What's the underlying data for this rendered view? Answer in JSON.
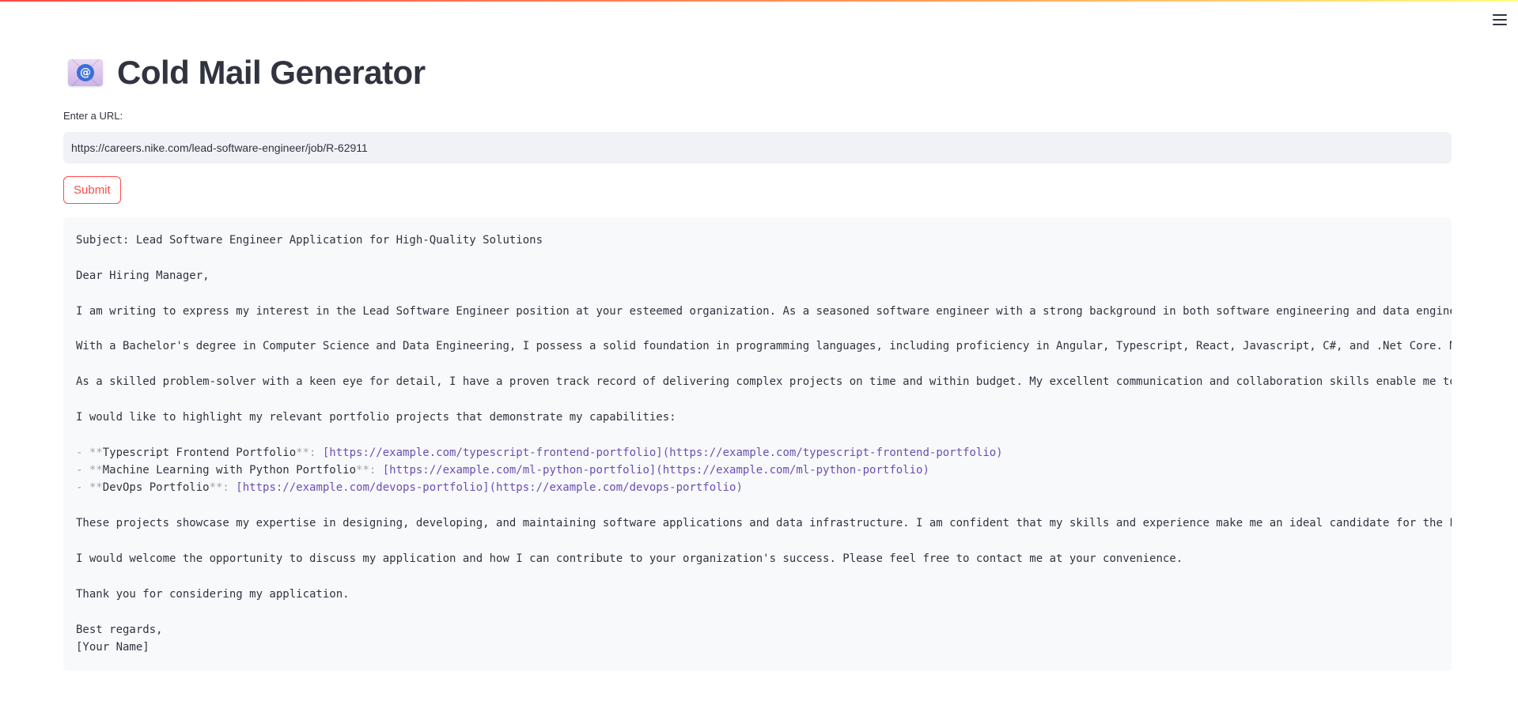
{
  "app": {
    "title": "Cold Mail Generator",
    "icon": "envelope-with-at-icon",
    "menu_icon": "hamburger-menu-icon"
  },
  "url_field": {
    "label": "Enter a URL:",
    "value": "https://careers.nike.com/lead-software-engineer/job/R-62911"
  },
  "submit_label": "Submit",
  "colors": {
    "accent": "#ff4b4b",
    "input_bg": "#f0f2f6",
    "code_bg": "#f8f9fb",
    "link": "#6a4fb3",
    "text": "#31333f"
  },
  "email": {
    "subject": "Subject: Lead Software Engineer Application for High-Quality Solutions",
    "greeting": "Dear Hiring Manager,",
    "p1": "I am writing to express my interest in the Lead Software Engineer position at your esteemed organization. As a seasoned software engineer with a strong background in both software engineering and data engine",
    "p2": "With a Bachelor's degree in Computer Science and Data Engineering, I possess a solid foundation in programming languages, including proficiency in Angular, Typescript, React, Javascript, C#, and .Net Core. M",
    "p3": "As a skilled problem-solver with a keen eye for detail, I have a proven track record of delivering complex projects on time and within budget. My excellent communication and collaboration skills enable me to",
    "p4": "I would like to highlight my relevant portfolio projects that demonstrate my capabilities:",
    "portfolio": [
      {
        "bullet": "- **",
        "name": "Typescript Frontend Portfolio",
        "sep": "**: ",
        "link": "[https://example.com/typescript-frontend-portfolio](https://example.com/typescript-frontend-portfolio)"
      },
      {
        "bullet": "- **",
        "name": "Machine Learning with Python Portfolio",
        "sep": "**: ",
        "link": "[https://example.com/ml-python-portfolio](https://example.com/ml-python-portfolio)"
      },
      {
        "bullet": "- **",
        "name": "DevOps Portfolio",
        "sep": "**: ",
        "link": "[https://example.com/devops-portfolio](https://example.com/devops-portfolio)"
      }
    ],
    "p5": "These projects showcase my expertise in designing, developing, and maintaining software applications and data infrastructure. I am confident that my skills and experience make me an ideal candidate for the L",
    "p6": "I would welcome the opportunity to discuss my application and how I can contribute to your organization's success. Please feel free to contact me at your convenience.",
    "p7": "Thank you for considering my application.",
    "closing": "Best regards,",
    "signature": "[Your Name]"
  }
}
